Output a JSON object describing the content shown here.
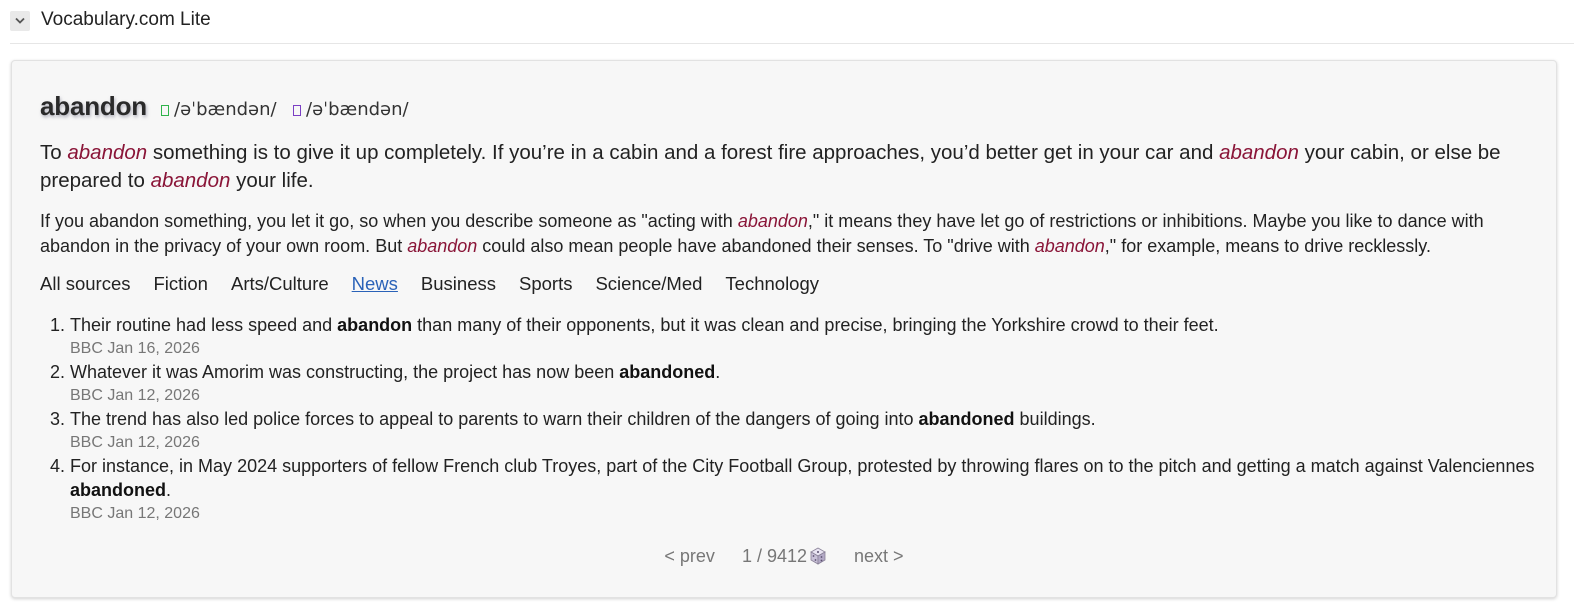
{
  "header": {
    "title": "Vocabulary.com Lite"
  },
  "entry": {
    "word": "abandon",
    "pron_us": "/əˈbændən/",
    "pron_uk": "/əˈbændən/",
    "short_def": {
      "p1": "To ",
      "w1": "abandon",
      "p2": " something is to give it up completely. If you’re in a cabin and a forest fire approaches, you’d better get in your car and ",
      "w2": "abandon",
      "p3": " your cabin, or else be prepared to ",
      "w3": "abandon",
      "p4": " your life."
    },
    "long_def": {
      "p1": "If you abandon something, you let it go, so when you describe someone as \"acting with ",
      "w1": "abandon",
      "p2": ",\" it means they have let go of restrictions or inhibitions. Maybe you like to dance with abandon in the privacy of your own room. But ",
      "w2": "abandon",
      "p3": " could also mean people have abandoned their senses. To \"drive with ",
      "w3": "abandon",
      "p4": ",\" for example, means to drive recklessly."
    }
  },
  "tabs": [
    "All sources",
    "Fiction",
    "Arts/Culture",
    "News",
    "Business",
    "Sports",
    "Science/Med",
    "Technology"
  ],
  "active_tab": "News",
  "examples": [
    {
      "num": "1.",
      "pre": "Their routine had less speed and ",
      "bold": "abandon",
      "post": " than many of their opponents, but it was clean and precise, bringing the Yorkshire crowd to their feet.",
      "source": "BBC Jan 16, 2026"
    },
    {
      "num": "2.",
      "pre": "Whatever it was Amorim was constructing, the project has now been ",
      "bold": "abandoned",
      "post": ".",
      "source": "BBC Jan 12, 2026"
    },
    {
      "num": "3.",
      "pre": "The trend has also led police forces to appeal to parents to warn their children of the dangers of going into ",
      "bold": "abandoned",
      "post": " buildings.",
      "source": "BBC Jan 12, 2026"
    },
    {
      "num": "4.",
      "pre": "For instance, in May 2024 supporters of fellow French club Troyes, part of the City Football Group, protested by throwing flares on to the pitch and getting a match against Valenciennes ",
      "bold": "abandoned",
      "post": ".",
      "source": "BBC Jan 12, 2026"
    }
  ],
  "pager": {
    "prev": "< prev",
    "count": "1 / 9412",
    "next": "next >"
  },
  "colors": {
    "highlight_word": "#8a1538",
    "active_tab": "#2a62b8",
    "us_speaker": "#2fb34a",
    "uk_speaker": "#7b3fc4"
  },
  "icons": {
    "collapse": "chevron-down-icon",
    "us_audio": "speaker-us-icon",
    "uk_audio": "speaker-uk-icon",
    "random": "dice-icon"
  }
}
